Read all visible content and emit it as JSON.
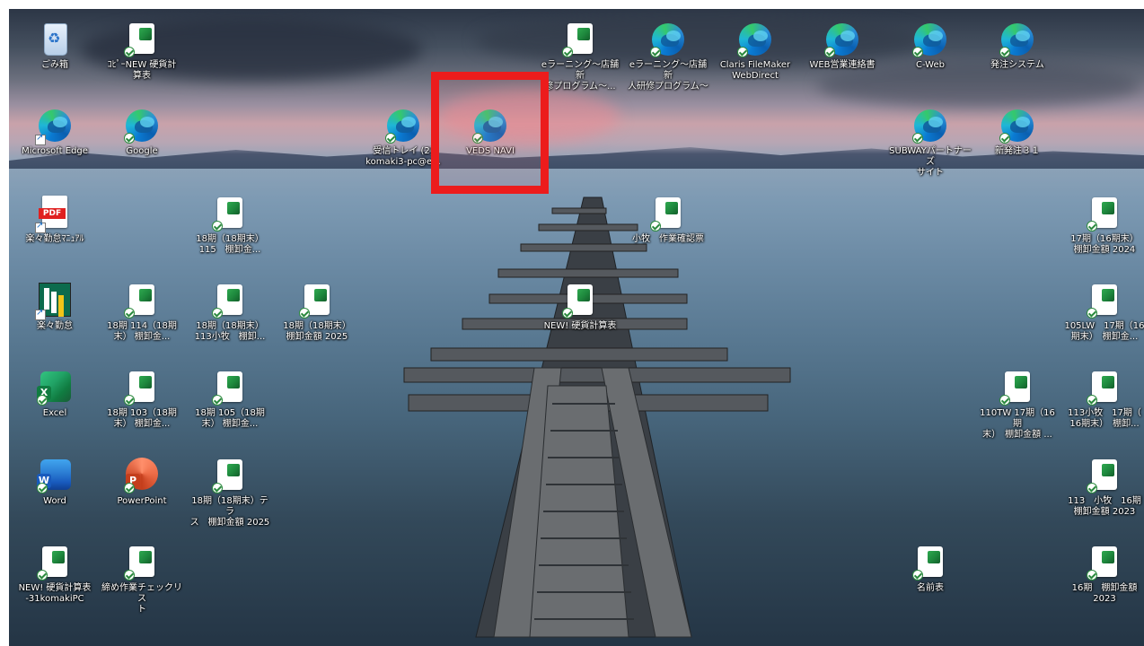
{
  "desktop": {
    "icons": [
      {
        "label": "ごみ箱",
        "kind": "recycle"
      },
      {
        "label": "ｺﾋﾟｰNEW 硬貨計\n算表",
        "kind": "sheet"
      },
      {
        "label": "eラーニング～店舗新\n修プログラム～...",
        "kind": "sheet"
      },
      {
        "label": "eラーニング～店舗新\n人研修プログラム～",
        "kind": "edge"
      },
      {
        "label": "Claris FileMaker\nWebDirect",
        "kind": "edge"
      },
      {
        "label": "WEB営業連絡書",
        "kind": "edge"
      },
      {
        "label": "C-Web",
        "kind": "edge"
      },
      {
        "label": "発注システム",
        "kind": "edge"
      },
      {
        "label": "Microsoft Edge",
        "kind": "edge-shortcut"
      },
      {
        "label": "Google",
        "kind": "edge"
      },
      {
        "label": "受信トレイ (2)\nkomaki3-pc@e...",
        "kind": "edge"
      },
      {
        "label": "VEDS NAVI",
        "kind": "edge"
      },
      {
        "label": "SUBWAYパートナーズ\nサイト",
        "kind": "edge"
      },
      {
        "label": "新発注３１",
        "kind": "edge"
      },
      {
        "label": "楽々勤怠ﾏﾆｭｱﾙ",
        "kind": "pdf"
      },
      {
        "label": "18期（18期末）\n115　棚卸金...",
        "kind": "sheet"
      },
      {
        "label": "小牧　作業確認票",
        "kind": "sheet"
      },
      {
        "label": "17期（16期末）\n棚卸金額 2024",
        "kind": "sheet"
      },
      {
        "label": "楽々勤怠",
        "kind": "rakuraku"
      },
      {
        "label": "18期 114（18期\n末） 棚卸金...",
        "kind": "sheet"
      },
      {
        "label": "18期（18期末）\n113小牧　棚卸...",
        "kind": "sheet"
      },
      {
        "label": "18期（18期末）\n棚卸金額 2025",
        "kind": "sheet"
      },
      {
        "label": "NEW! 硬貨計算表",
        "kind": "sheet"
      },
      {
        "label": "105LW　17期（16\n期末）　棚卸金...",
        "kind": "sheet"
      },
      {
        "label": "Excel",
        "kind": "excel"
      },
      {
        "label": "18期 103（18期\n末） 棚卸金...",
        "kind": "sheet"
      },
      {
        "label": "18期 105（18期\n末） 棚卸金...",
        "kind": "sheet"
      },
      {
        "label": "110TW 17期（16期\n末）　棚卸金額 ...",
        "kind": "sheet"
      },
      {
        "label": "113小牧　17期（\n16期末）　棚卸...",
        "kind": "sheet"
      },
      {
        "label": "Word",
        "kind": "word"
      },
      {
        "label": "PowerPoint",
        "kind": "powerpoint"
      },
      {
        "label": "18期（18期末）テラ\nス　棚卸金額 2025",
        "kind": "sheet"
      },
      {
        "label": "113　小牧　16期\n棚卸金額 2023",
        "kind": "sheet"
      },
      {
        "label": "NEW! 硬貨計算表\n-31komakiPC",
        "kind": "sheet"
      },
      {
        "label": "締め作業チェックリス\nト",
        "kind": "sheet"
      },
      {
        "label": "名前表",
        "kind": "sheet"
      },
      {
        "label": "16期　棚卸金額\n2023",
        "kind": "sheet"
      }
    ]
  },
  "colors": {
    "highlight": "#ec1c1c",
    "label_text": "#ffffff"
  }
}
